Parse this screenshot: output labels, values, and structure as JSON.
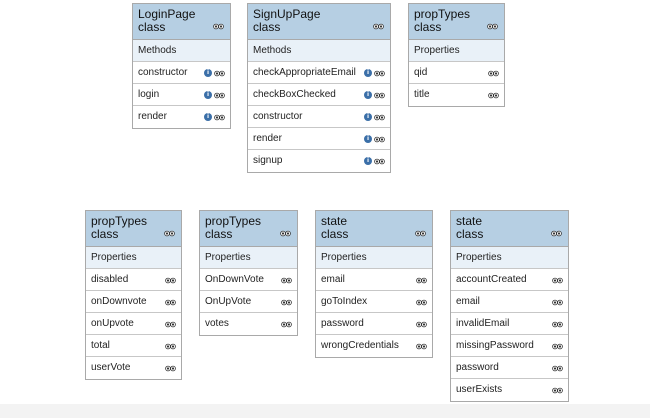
{
  "colors": {
    "header_fill": "#b6cfe3",
    "section_fill": "#e9f1f8",
    "border": "#a9a9a9",
    "info_icon": "#3b6fa8"
  },
  "icons": {
    "info": "info-icon",
    "visibility": "eyes-icon"
  },
  "classes": [
    {
      "name": "LoginPage",
      "kind": "class",
      "section": "Methods",
      "members": [
        "constructor",
        "login",
        "render"
      ],
      "info": true
    },
    {
      "name": "SignUpPage",
      "kind": "class",
      "section": "Methods",
      "members": [
        "checkAppropriateEmail",
        "checkBoxChecked",
        "constructor",
        "render",
        "signup"
      ],
      "info": true
    },
    {
      "name": "propTypes",
      "kind": "class",
      "section": "Properties",
      "members": [
        "qid",
        "title"
      ],
      "info": false
    },
    {
      "name": "propTypes",
      "kind": "class",
      "section": "Properties",
      "members": [
        "disabled",
        "onDownvote",
        "onUpvote",
        "total",
        "userVote"
      ],
      "info": false
    },
    {
      "name": "propTypes",
      "kind": "class",
      "section": "Properties",
      "members": [
        "OnDownVote",
        "OnUpVote",
        "votes"
      ],
      "info": false
    },
    {
      "name": "state",
      "kind": "class",
      "section": "Properties",
      "members": [
        "email",
        "goToIndex",
        "password",
        "wrongCredentials"
      ],
      "info": false
    },
    {
      "name": "state",
      "kind": "class",
      "section": "Properties",
      "members": [
        "accountCreated",
        "email",
        "invalidEmail",
        "missingPassword",
        "password",
        "userExists"
      ],
      "info": false
    }
  ]
}
